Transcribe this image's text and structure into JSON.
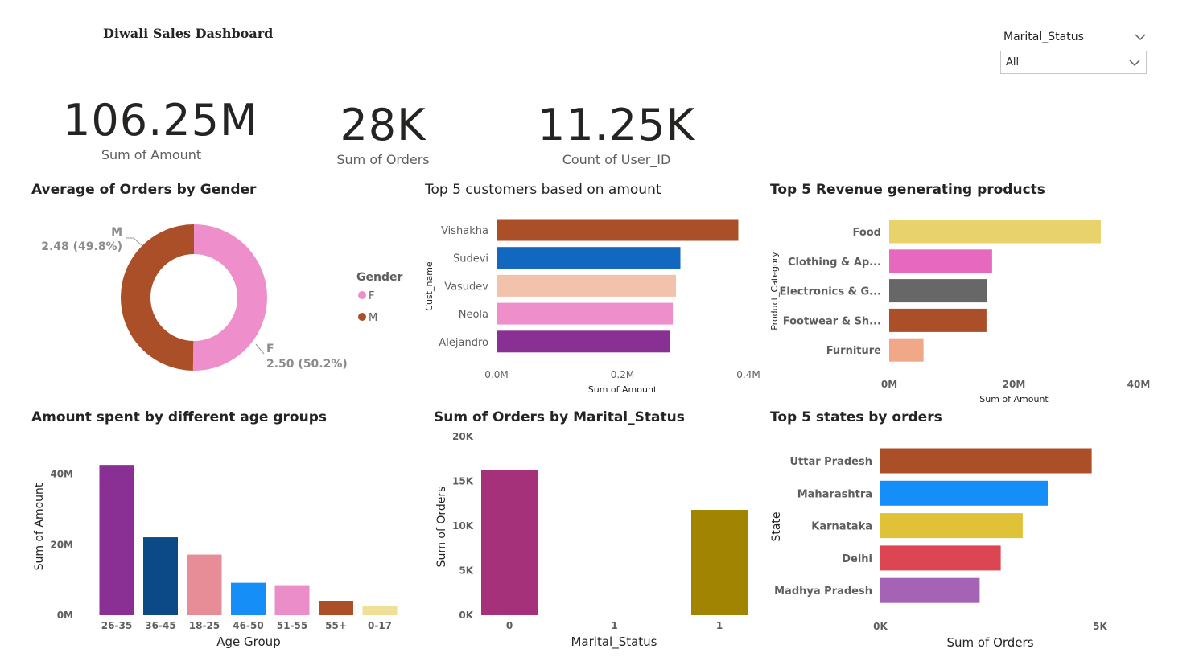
{
  "dashboard": {
    "title": "Diwali Sales Dashboard"
  },
  "slicer": {
    "label": "Marital_Status",
    "value": "All"
  },
  "kpis": [
    {
      "value": "106.25M",
      "label": "Sum of Amount"
    },
    {
      "value": "28K",
      "label": "Sum of Orders"
    },
    {
      "value": "11.25K",
      "label": "Count of User_ID"
    }
  ],
  "visuals": {
    "gender": "Average of Orders by Gender",
    "customers": "Top 5 customers based on amount",
    "products": "Top 5 Revenue generating products",
    "age": "Amount spent by different age groups",
    "marital": "Sum of Orders by Marital_Status",
    "states": "Top 5 states by orders"
  },
  "colors": {
    "pink": "#ee8fcb",
    "brown": "#ab4f28",
    "blue": "#1267bf",
    "peach": "#f3c2ac",
    "purple": "#8a2f93",
    "yellow": "#e7d26b",
    "magenta": "#e769bf",
    "gray": "#676767",
    "salmon": "#f0a888",
    "navy": "#0b4a86",
    "rose": "#e68d98",
    "skyblue": "#168ef7",
    "lightpink": "#ea8dc9",
    "cream": "#efe098",
    "berry": "#a4317a",
    "olive": "#a18502",
    "gold": "#e0c238",
    "red": "#db4652",
    "lavender": "#a463b4"
  },
  "chart_data": [
    {
      "type": "pie",
      "title": "Average of Orders by Gender",
      "legend_title": "Gender",
      "legend_position": "right",
      "slices": [
        {
          "name": "F",
          "value": 2.5,
          "label": "2.50 (50.2%)",
          "color": "#ee8fcb"
        },
        {
          "name": "M",
          "value": 2.48,
          "label": "2.48 (49.8%)",
          "color": "#ab4f28"
        }
      ]
    },
    {
      "type": "bar",
      "orientation": "horizontal",
      "title": "Top 5 customers based on amount",
      "categories": [
        "Vishakha",
        "Sudevi",
        "Vasudev",
        "Neola",
        "Alejandro"
      ],
      "values": [
        0.384,
        0.292,
        0.285,
        0.28,
        0.275
      ],
      "colors": [
        "#ab4f28",
        "#1267bf",
        "#f3c2ac",
        "#ee8fcb",
        "#8a2f93"
      ],
      "xlabel": "Sum of Amount",
      "ylabel": "Cust_name",
      "xlim": [
        0,
        0.4
      ],
      "ticks": [
        "0.0M",
        "0.2M",
        "0.4M"
      ]
    },
    {
      "type": "bar",
      "orientation": "horizontal",
      "title": "Top 5 Revenue generating products",
      "categories": [
        "Food",
        "Clothing & Ap...",
        "Electronics & G...",
        "Footwear & Sh...",
        "Furniture"
      ],
      "values": [
        33.93,
        16.5,
        15.7,
        15.6,
        5.5
      ],
      "colors": [
        "#e7d26b",
        "#e769bf",
        "#676767",
        "#ab4f28",
        "#f0a888"
      ],
      "xlabel": "Sum of Amount",
      "ylabel": "Product_Category",
      "xlim": [
        0,
        40
      ],
      "ticks": [
        "0M",
        "20M",
        "40M"
      ]
    },
    {
      "type": "bar",
      "title": "Amount spent by different age groups",
      "categories": [
        "26-35",
        "36-45",
        "18-25",
        "46-50",
        "51-55",
        "55+",
        "0-17"
      ],
      "values": [
        42.6,
        22.1,
        17.2,
        9.2,
        8.3,
        4.1,
        2.7
      ],
      "colors": [
        "#8a2f93",
        "#0b4a86",
        "#e68d98",
        "#168ef7",
        "#ea8dc9",
        "#ab4f28",
        "#efe098"
      ],
      "xlabel": "Age Group",
      "ylabel": "Sum of Amount",
      "ylim": [
        0,
        44
      ],
      "ticks": [
        "0M",
        "20M",
        "40M"
      ]
    },
    {
      "type": "bar",
      "title": "Sum of Orders by Marital_Status",
      "categories": [
        "0",
        "1",
        "1"
      ],
      "values": [
        16.3,
        0,
        11.8
      ],
      "colors": [
        "#a4317a",
        "#a4317a",
        "#a18502"
      ],
      "xlabel": "Marital_Status",
      "ylabel": "Sum of Orders",
      "ylim": [
        0,
        20
      ],
      "ticks": [
        "0K",
        "5K",
        "10K",
        "15K",
        "20K"
      ]
    },
    {
      "type": "bar",
      "orientation": "horizontal",
      "title": "Top 5 states by orders",
      "categories": [
        "Uttar Pradesh",
        "Maharashtra",
        "Karnataka",
        "Delhi",
        "Madhya Pradesh"
      ],
      "values": [
        4.81,
        3.81,
        3.24,
        2.74,
        2.26
      ],
      "colors": [
        "#ab4f28",
        "#168ef7",
        "#e0c238",
        "#db4652",
        "#a463b4"
      ],
      "xlabel": "Sum of Orders",
      "ylabel": "State",
      "xlim": [
        0,
        5
      ],
      "ticks": [
        "0K",
        "5K"
      ]
    }
  ]
}
